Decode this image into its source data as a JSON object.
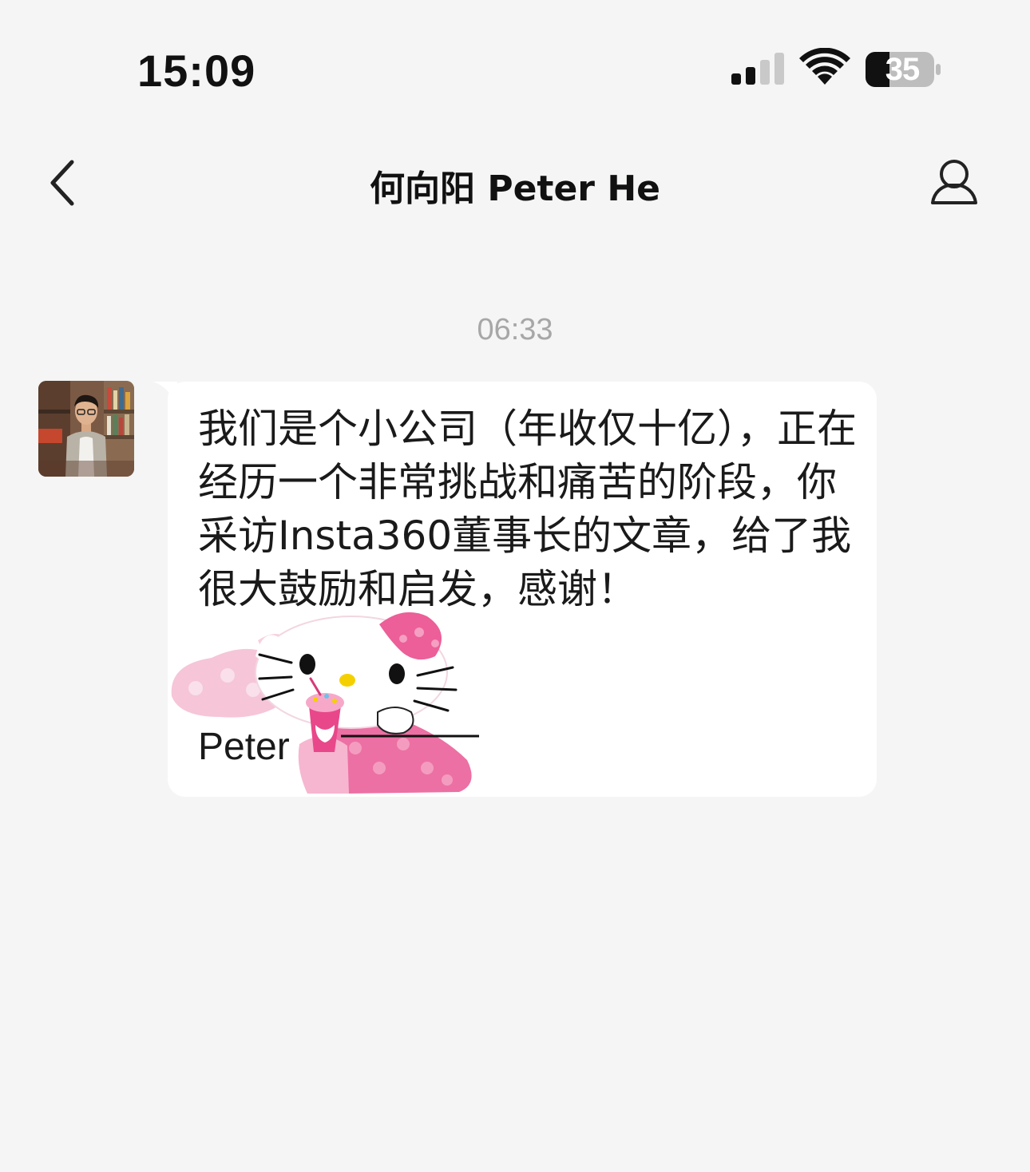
{
  "status_bar": {
    "time": "15:09",
    "battery_level": "35",
    "signal_bars_active": 2,
    "signal_bars_total": 4
  },
  "nav": {
    "title": "何向阳 Peter He",
    "back_icon": "chevron-left-icon",
    "profile_icon": "person-icon"
  },
  "chat": {
    "timestamp": "06:33",
    "message": {
      "sender_avatar": "avatar",
      "text": "我们是个小公司（年收仅十亿），正在经历一个非常挑战和痛苦的阶段，你采访Insta360董事长的文章，给了我很大鼓励和启发，感谢！",
      "signature": "Peter"
    }
  },
  "colors": {
    "background": "#f4f5f4",
    "bubble": "#ffffff",
    "timestamp": "#a7a7a7",
    "text": "#1a1a1a"
  }
}
